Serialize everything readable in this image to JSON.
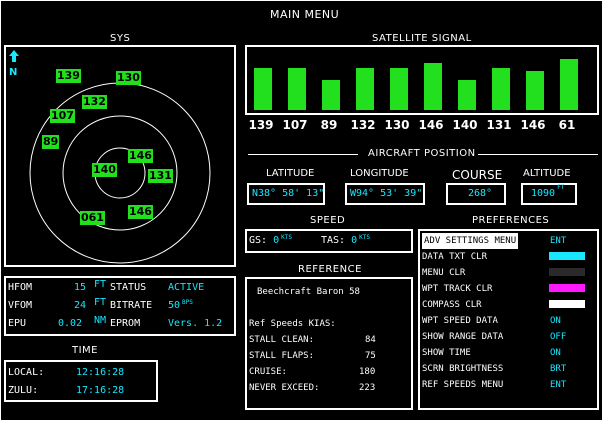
{
  "title": "MAIN MENU",
  "sys": {
    "label": "SYS",
    "north": "N",
    "satellites": [
      "139",
      "130",
      "132",
      "107",
      "89",
      "146",
      "140",
      "131",
      "061",
      "146"
    ]
  },
  "signal": {
    "label": "SATELLITE SIGNAL",
    "bars": [
      {
        "id": "139",
        "level": 0.75
      },
      {
        "id": "107",
        "level": 0.75
      },
      {
        "id": "89",
        "level": 0.55
      },
      {
        "id": "132",
        "level": 0.75
      },
      {
        "id": "130",
        "level": 0.75
      },
      {
        "id": "146",
        "level": 0.85
      },
      {
        "id": "140",
        "level": 0.55
      },
      {
        "id": "131",
        "level": 0.75
      },
      {
        "id": "146",
        "level": 0.7
      },
      {
        "id": "61",
        "level": 0.92
      }
    ]
  },
  "aircraft": {
    "label": "AIRCRAFT POSITION",
    "latitude_label": "LATITUDE",
    "latitude": "N38° 58' 13\"",
    "longitude_label": "LONGITUDE",
    "longitude": "W94° 53' 39\"",
    "course_label": "COURSE",
    "course": "268°",
    "altitude_label": "ALTITUDE",
    "altitude": "1090",
    "altitude_unit": "FT"
  },
  "speed": {
    "label": "SPEED",
    "gs_label": "GS:",
    "gs_value": "0",
    "tas_label": "TAS:",
    "tas_value": "0",
    "unit": "KTS"
  },
  "status": {
    "hfom_label": "HFOM",
    "hfom_value": "15",
    "vfom_label": "VFOM",
    "vfom_value": "24",
    "epu_label": "EPU",
    "epu_value": "0.02",
    "ft_unit": "FT",
    "nm_unit": "NM",
    "status_label": "STATUS",
    "status_value": "ACTIVE",
    "bitrate_label": "BITRATE",
    "bitrate_value": "50",
    "bitrate_unit": "BPS",
    "eprom_label": "EPROM",
    "eprom_value": "Vers. 1.2"
  },
  "reference": {
    "label": "REFERENCE",
    "aircraft": "Beechcraft Baron 58",
    "speeds_label": "Ref Speeds KIAS:",
    "rows": [
      {
        "label": "STALL CLEAN:",
        "value": "84"
      },
      {
        "label": "STALL FLAPS:",
        "value": "75"
      },
      {
        "label": "CRUISE:",
        "value": "180"
      },
      {
        "label": "NEVER EXCEED:",
        "value": "223"
      }
    ]
  },
  "time": {
    "label": "TIME",
    "local_label": "LOCAL:",
    "local_value": "12:16:28",
    "zulu_label": "ZULU:",
    "zulu_value": "17:16:28"
  },
  "preferences": {
    "label": "PREFERENCES",
    "items": [
      {
        "label": "ADV SETTINGS MENU",
        "value": "ENT",
        "selected": true
      },
      {
        "label": "DATA TXT CLR",
        "swatch": "#19e6ff"
      },
      {
        "label": "MENU CLR",
        "swatch": "#2a2a2a"
      },
      {
        "label": "WPT TRACK CLR",
        "swatch": "#ff19ff"
      },
      {
        "label": "COMPASS CLR",
        "swatch": "#ffffff"
      },
      {
        "label": "WPT SPEED DATA",
        "value": "ON"
      },
      {
        "label": "SHOW RANGE DATA",
        "value": "OFF"
      },
      {
        "label": "SHOW TIME",
        "value": "ON"
      },
      {
        "label": "SCRN BRIGHTNESS",
        "value": "BRT"
      },
      {
        "label": "REF SPEEDS MENU",
        "value": "ENT"
      }
    ]
  },
  "colors": {
    "data_text": "#19e6ff",
    "satellite_green": "#22e01e",
    "background": "#000000"
  }
}
